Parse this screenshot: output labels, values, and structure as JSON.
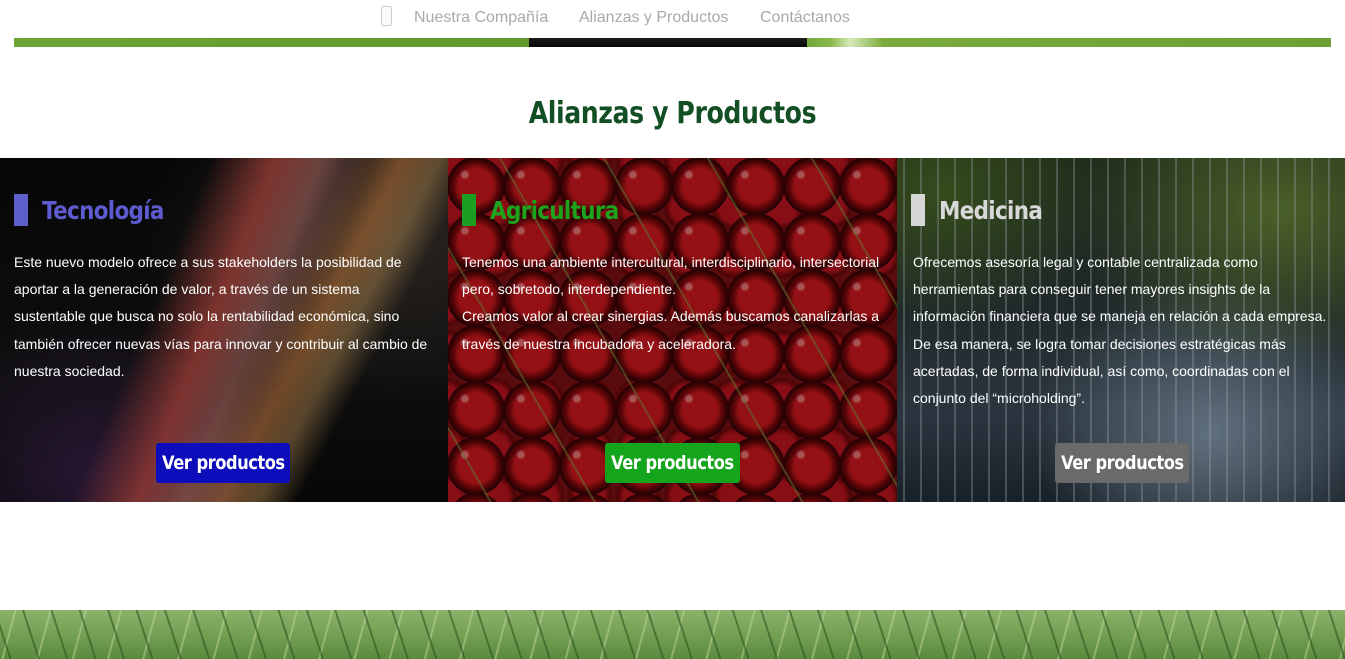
{
  "nav": {
    "items": [
      "Nuestra Compañía",
      "Alianzas y Productos",
      "Contáctanos"
    ]
  },
  "section": {
    "title": "Alianzas y Productos"
  },
  "panels": [
    {
      "title": "Tecnología",
      "accent": "#5d5bd0",
      "paragraphs": [
        "Este nuevo modelo ofrece a sus stakeholders la posibilidad de aportar a la generación de valor, a través de un sistema sustentable que busca no solo la rentabilidad económica, sino también ofrecer nuevas vías para innovar y contribuir al cambio de nuestra sociedad."
      ],
      "button": "Ver productos",
      "button_color": "#0d0dbb"
    },
    {
      "title": "Agricultura",
      "accent": "#1ea31c",
      "paragraphs": [
        "Tenemos una ambiente intercultural, interdisciplinario, intersectorial pero, sobretodo, interdependiente.",
        "Creamos valor al crear sinergias. Además buscamos canalizarlas a través de nuestra incubadora y aceleradora."
      ],
      "button": "Ver productos",
      "button_color": "#15a51d"
    },
    {
      "title": "Medicina",
      "accent": "#d9d9d9",
      "paragraphs": [
        "Ofrecemos asesoría legal y contable centralizada como herramientas para conseguir tener mayores insights de la información financiera que se maneja en relación a cada empresa. De esa manera, se logra tomar decisiones estratégicas más acertadas, de forma individual, así como, coordinadas con el conjunto del “microholding”."
      ],
      "button": "Ver productos",
      "button_color": "#6a6a6a"
    }
  ]
}
